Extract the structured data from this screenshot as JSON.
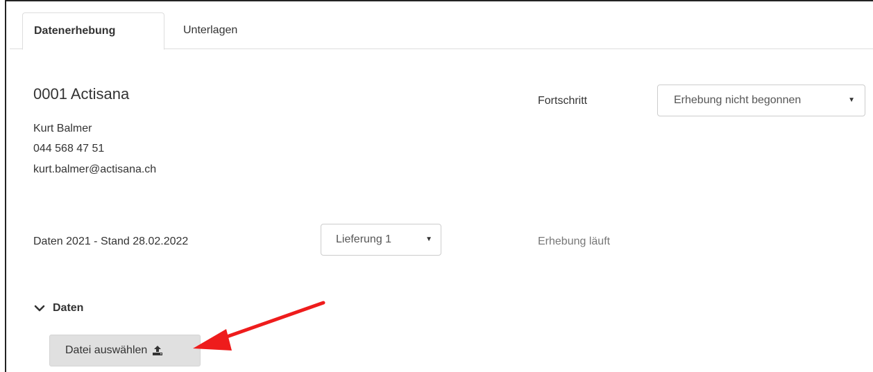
{
  "tabs": [
    {
      "label": "Datenerhebung",
      "active": true
    },
    {
      "label": "Unterlagen",
      "active": false
    }
  ],
  "org": {
    "title": "0001 Actisana",
    "contact_name": "Kurt Balmer",
    "phone": "044 568 47 51",
    "email": "kurt.balmer@actisana.ch"
  },
  "progress": {
    "label": "Fortschritt",
    "selected": "Erhebung nicht begonnen"
  },
  "data_row": {
    "label": "Daten 2021 - Stand 28.02.2022",
    "delivery_selected": "Lieferung 1",
    "status": "Erhebung läuft"
  },
  "section": {
    "title": "Daten",
    "upload_label": "Datei auswählen"
  },
  "icons": {
    "caret": "caret-down-icon",
    "chevron": "chevron-down-icon",
    "upload": "upload-icon"
  },
  "colors": {
    "annotation_arrow": "#ee1c1c",
    "button_bg": "#e0e0e0",
    "status_text": "#777777"
  }
}
